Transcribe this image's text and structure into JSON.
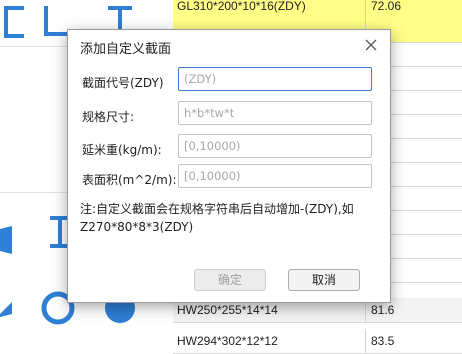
{
  "table": {
    "rows": [
      {
        "name": "GL310*200*10*16(ZDY)",
        "value": "72.06",
        "style": "yellow"
      },
      {
        "name": "",
        "value": "",
        "style": "yellow"
      },
      {
        "name": "HW250*255*14*14",
        "value": "81.6",
        "style": "grey"
      },
      {
        "name": "HW294*302*12*12",
        "value": "83.5",
        "style": "plain"
      }
    ]
  },
  "dialog": {
    "title": "添加自定义截面",
    "fields": [
      {
        "label": "截面代号(ZDY)",
        "value": "",
        "placeholder": "(ZDY)"
      },
      {
        "label": "规格尺寸:",
        "value": "",
        "placeholder": "h*b*tw*t"
      },
      {
        "label": "延米重(kg/m):",
        "value": "",
        "placeholder": "[0,10000)"
      },
      {
        "label": "表面积(m^2/m):",
        "value": "",
        "placeholder": "[0,10000)"
      }
    ],
    "note": "注:自定义截面会在规格字符串后自动增加-(ZDY),如Z270*80*8*3(ZDY)",
    "ok_label": "确定",
    "cancel_label": "取消"
  },
  "colors": {
    "accent": "#3b7bd4",
    "shape_blue": "#2f7fd6",
    "highlight_yellow": "#ffff88"
  },
  "icons": {
    "close": "close-icon",
    "shapes": [
      "c-channel-icon",
      "z-section-icon",
      "i-beam-icon",
      "angle-icon",
      "t-section-icon",
      "circle-pipe-icon"
    ]
  }
}
